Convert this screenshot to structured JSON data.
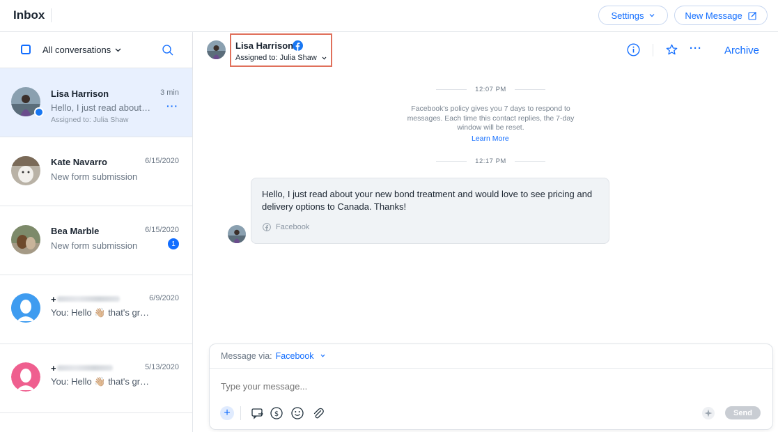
{
  "header": {
    "title": "Inbox",
    "settings_label": "Settings",
    "new_message_label": "New Message"
  },
  "sidebar": {
    "filter_label": "All conversations",
    "conversations": [
      {
        "name": "Lisa Harrison",
        "preview": "Hello, I just read about your new bond treatment",
        "time": "3 min",
        "assigned": "Assigned to: Julia Shaw",
        "channel": "facebook"
      },
      {
        "name": "Kate Navarro",
        "preview": "New form submission",
        "time": "6/15/2020"
      },
      {
        "name": "Bea Marble",
        "preview": "New form submission",
        "time": "6/15/2020",
        "unread": "1"
      },
      {
        "name": "+",
        "preview": "You: Hello 👋🏼 that's great to hear",
        "time": "6/9/2020"
      },
      {
        "name": "+",
        "preview": "You: Hello 👋🏼 that's great to hear",
        "time": "5/13/2020"
      }
    ]
  },
  "chat": {
    "contact_name": "Lisa Harrison",
    "assigned": "Assigned to: Julia Shaw",
    "archive_label": "Archive",
    "time1": "12:07 PM",
    "policy_text": "Facebook's policy gives you 7 days to respond to messages. Each time this contact replies, the 7-day window will be reset.",
    "learn_more": "Learn More",
    "time2": "12:17 PM",
    "message_text": "Hello, I just read about your new bond treatment and would love to see pricing and delivery options to Canada. Thanks!",
    "message_source": "Facebook"
  },
  "composer": {
    "via_label": "Message via:",
    "via_value": "Facebook",
    "placeholder": "Type your message...",
    "send_label": "Send"
  },
  "colors": {
    "accent": "#116dff",
    "highlight_box": "#e0705b",
    "active_row": "#e8f0fe",
    "facebook": "#1877f2"
  }
}
